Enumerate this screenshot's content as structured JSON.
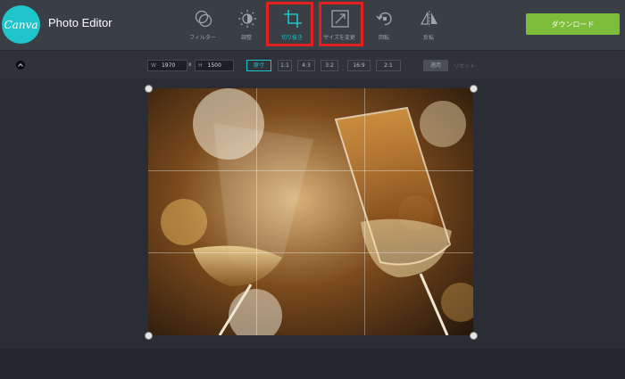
{
  "app": {
    "logo_text": "Canva",
    "title": "Photo Editor"
  },
  "tools": [
    {
      "label": "フィルター",
      "icon": "filter-icon"
    },
    {
      "label": "調整",
      "icon": "adjust-icon"
    },
    {
      "label": "切り抜き",
      "icon": "crop-icon"
    },
    {
      "label": "サイズを変更",
      "icon": "resize-icon"
    },
    {
      "label": "回転",
      "icon": "rotate-icon"
    },
    {
      "label": "反転",
      "icon": "flip-icon"
    }
  ],
  "active_tool": "切り抜き",
  "download_label": "ダウンロード",
  "crop": {
    "width_key": "W",
    "width_value": "1970",
    "sep": "x",
    "height_key": "H",
    "height_value": "1500",
    "ratios": [
      "原寸",
      "1:1",
      "4:3",
      "3:2",
      "16:9",
      "2:1"
    ],
    "selected_ratio": "原寸",
    "apply_label": "適用",
    "reset_label": "リセット"
  },
  "colors": {
    "accent": "#20c4cb",
    "download": "#7ebd3a",
    "highlight": "#e41f1f"
  }
}
